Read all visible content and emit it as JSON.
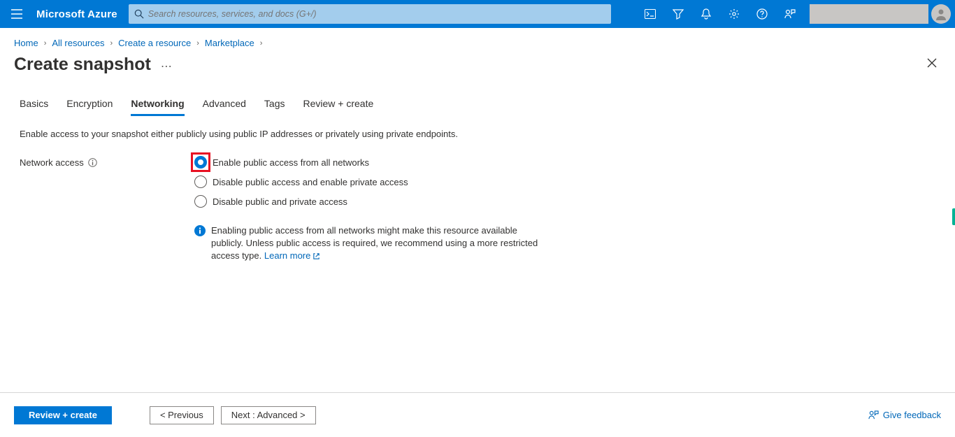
{
  "brand": "Microsoft Azure",
  "search": {
    "placeholder": "Search resources, services, and docs (G+/)"
  },
  "breadcrumbs": [
    "Home",
    "All resources",
    "Create a resource",
    "Marketplace"
  ],
  "page": {
    "title": "Create snapshot"
  },
  "tabs": [
    "Basics",
    "Encryption",
    "Networking",
    "Advanced",
    "Tags",
    "Review + create"
  ],
  "active_tab_index": 2,
  "intro": "Enable access to your snapshot either publicly using public IP addresses or privately using private endpoints.",
  "form": {
    "network_access_label": "Network access",
    "options": [
      "Enable public access from all networks",
      "Disable public access and enable private access",
      "Disable public and private access"
    ],
    "selected_option_index": 0,
    "info_text": "Enabling public access from all networks might make this resource available publicly. Unless public access is required, we recommend using a more restricted access type.",
    "learn_more": "Learn more"
  },
  "footer": {
    "review": "Review + create",
    "previous": "< Previous",
    "next": "Next : Advanced >",
    "feedback": "Give feedback"
  }
}
